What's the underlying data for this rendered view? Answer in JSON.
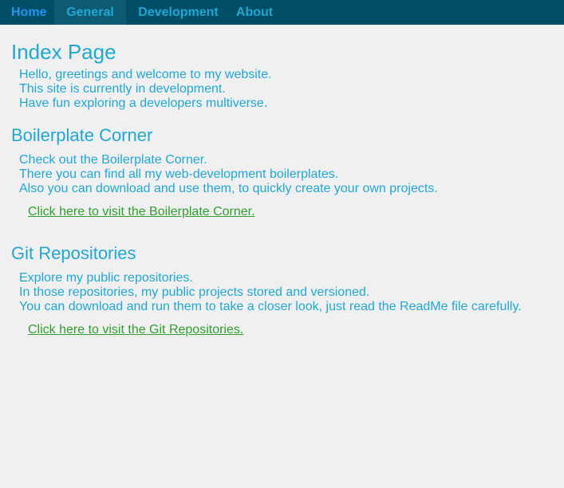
{
  "nav": {
    "items": [
      {
        "label": "Home"
      },
      {
        "label": "General"
      },
      {
        "label": "Development"
      },
      {
        "label": "About"
      }
    ]
  },
  "index": {
    "title": "Index Page",
    "lines": [
      "Hello, greetings and welcome to my website.",
      "This site is currently in development.",
      "Have fun exploring a developers multiverse."
    ]
  },
  "boilerplate": {
    "title": "Boilerplate Corner",
    "lines": [
      "Check out the Boilerplate Corner.",
      "There you can find all my web-development boilerplates.",
      "Also you can download and use them, to quickly create your own projects."
    ],
    "link": "Click here to visit the Boilerplate Corner."
  },
  "git": {
    "title": "Git Repositories",
    "lines": [
      "Explore my public repositories.",
      "In those repositories, my public projects stored and versioned.",
      "You can download and run them to take a closer look, just read the ReadMe file carefully."
    ],
    "link": "Click here to visit the Git Repositories."
  },
  "colors": {
    "nav_bg": "#004d66",
    "accent": "#1fa8d6",
    "link": "#2ea02e"
  }
}
